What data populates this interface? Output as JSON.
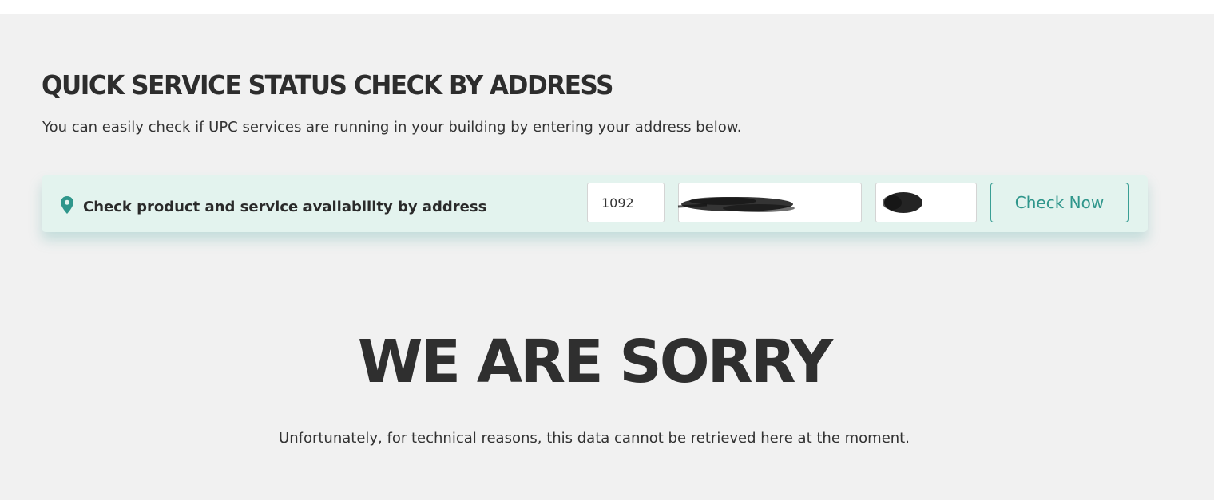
{
  "service_check": {
    "title": "QUICK SERVICE STATUS CHECK BY ADDRESS",
    "description": "You can easily check if UPC services are running in your building by entering your address below."
  },
  "availability_bar": {
    "label": "Check product and service availability by address",
    "icon": "location-pin-icon",
    "house_number_value": "1092",
    "street_value": "",
    "door_value": "",
    "button_label": "Check Now"
  },
  "error": {
    "title": "WE ARE SORRY",
    "message": "Unfortunately, for technical reasons, this data cannot be retrieved here at the moment."
  },
  "colors": {
    "page_background": "#f1f1f1",
    "bar_background": "#e3f3ee",
    "accent": "#2f968b",
    "heading": "#2d2d2d"
  }
}
